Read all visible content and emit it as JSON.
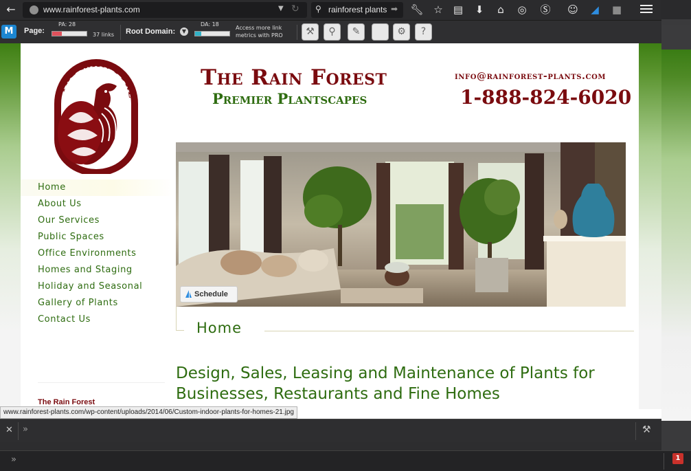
{
  "browser": {
    "url": "www.rainforest-plants.com",
    "search_text": "rainforest plants",
    "status_url": "www.rainforest-plants.com/wp-content/uploads/2014/06/Custom-indoor-plants-for-homes-21.jpg"
  },
  "mozbar": {
    "logo": "M",
    "page_label": "Page:",
    "pa_label": "PA: 28",
    "pa_value": 28,
    "links_label": "37 links",
    "root_domain_label": "Root Domain:",
    "da_label": "DA: 18",
    "da_value": 18,
    "pro_text": "Access more link metrics with PRO"
  },
  "site": {
    "title": "The Rain Forest",
    "subtitle": "Premier Plantscapes",
    "email": "info@rainforest-plants.com",
    "phone": "1-888-824-6020",
    "logo_text": "THE RAIN FOREST",
    "schedule_label": "Schedule"
  },
  "nav": {
    "items": [
      {
        "label": "Home",
        "active": true
      },
      {
        "label": "About Us"
      },
      {
        "label": "Our Services"
      },
      {
        "label": "Public Spaces"
      },
      {
        "label": "Office Environments"
      },
      {
        "label": "Homes and Staging"
      },
      {
        "label": "Holiday and Seasonal"
      },
      {
        "label": "Gallery of Plants"
      },
      {
        "label": "Contact Us"
      }
    ]
  },
  "main": {
    "section_title": "Home",
    "headline": "Design, Sales, Leasing and Maintenance of Plants for Businesses, Restaurants and Fine Homes",
    "sidebar_heading": "The Rain Forest"
  },
  "addonbar": {
    "badge_count": "1"
  },
  "colors": {
    "brand_red": "#7a0b0f",
    "brand_green": "#2e6c10",
    "header_green": "#3e7f14"
  }
}
